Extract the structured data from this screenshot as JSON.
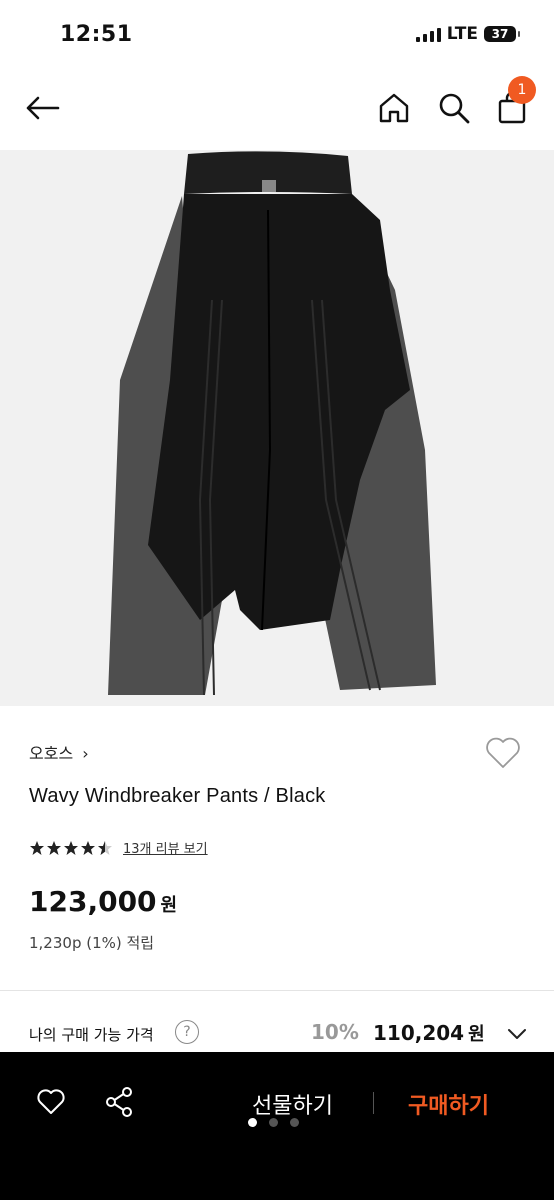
{
  "status_bar": {
    "time": "12:51",
    "network": "LTE",
    "battery": "37"
  },
  "nav": {
    "cart_count": "1"
  },
  "product": {
    "brand": "오호스",
    "brand_chevron": "›",
    "name": "Wavy Windbreaker Pants / Black",
    "rating": 4.5,
    "review_link": "13개 리뷰 보기",
    "price": "123,000",
    "price_unit": "원",
    "points": "1,230p (1%) 적립"
  },
  "my_price": {
    "label": "나의 구매 가능 가격",
    "help": "?",
    "discount": "10%",
    "price": "110,204",
    "unit": "원"
  },
  "bottom_bar": {
    "gift_label": "선물하기",
    "buy_label": "구매하기",
    "carousel_pages": 3,
    "carousel_active": 1
  },
  "colors": {
    "accent": "#f05a22",
    "bar_bg": "#000000"
  },
  "icons": [
    "back-arrow-icon",
    "home-icon",
    "search-icon",
    "bag-icon",
    "heart-icon",
    "star-icon",
    "question-icon",
    "chevron-down-icon",
    "share-icon"
  ]
}
